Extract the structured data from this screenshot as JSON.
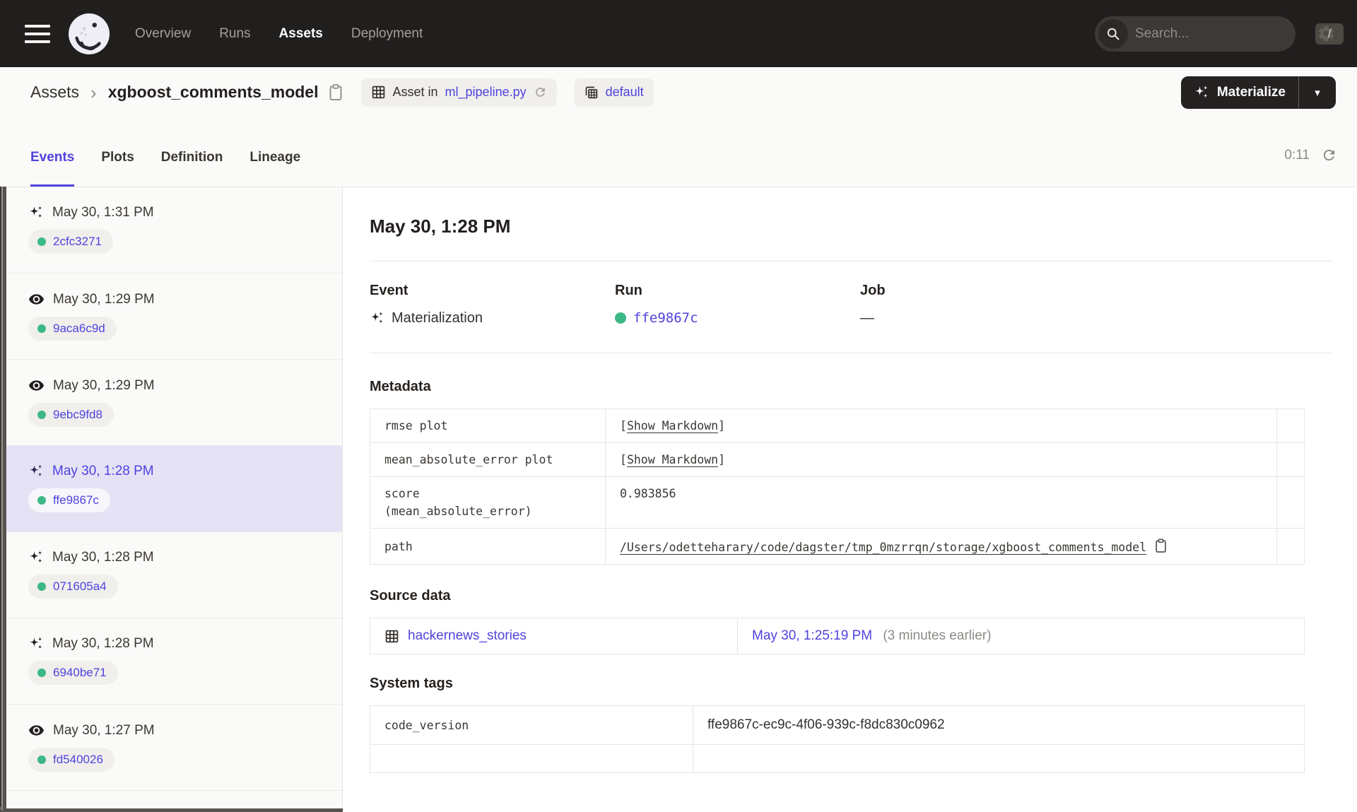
{
  "header": {
    "nav": [
      {
        "label": "Overview",
        "active": false
      },
      {
        "label": "Runs",
        "active": false
      },
      {
        "label": "Assets",
        "active": true
      },
      {
        "label": "Deployment",
        "active": false
      }
    ],
    "search": {
      "placeholder": "Search...",
      "shortcut": "/"
    }
  },
  "breadcrumb": {
    "root": "Assets",
    "separator": "›",
    "title": "xgboost_comments_model",
    "asset_tag": {
      "prefix": "Asset in",
      "file": "ml_pipeline.py"
    },
    "repo_tag": "default",
    "materialize_label": "Materialize",
    "caret": "▾"
  },
  "tabs": {
    "items": [
      "Events",
      "Plots",
      "Definition",
      "Lineage"
    ],
    "active": "Events",
    "timer": "0:11"
  },
  "sidebar": {
    "items": [
      {
        "type": "materialization",
        "time": "May 30, 1:31 PM",
        "run_id": "2cfc3271",
        "selected": false
      },
      {
        "type": "observation",
        "time": "May 30, 1:29 PM",
        "run_id": "9aca6c9d",
        "selected": false
      },
      {
        "type": "observation",
        "time": "May 30, 1:29 PM",
        "run_id": "9ebc9fd8",
        "selected": false
      },
      {
        "type": "materialization",
        "time": "May 30, 1:28 PM",
        "run_id": "ffe9867c",
        "selected": true
      },
      {
        "type": "materialization",
        "time": "May 30, 1:28 PM",
        "run_id": "071605a4",
        "selected": false
      },
      {
        "type": "materialization",
        "time": "May 30, 1:28 PM",
        "run_id": "6940be71",
        "selected": false
      },
      {
        "type": "observation",
        "time": "May 30, 1:27 PM",
        "run_id": "fd540026",
        "selected": false
      }
    ]
  },
  "main": {
    "heading": "May 30, 1:28 PM",
    "summary": {
      "event_label": "Event",
      "event_value": "Materialization",
      "run_label": "Run",
      "run_value": "ffe9867c",
      "job_label": "Job",
      "job_value": "—"
    },
    "metadata": {
      "heading": "Metadata",
      "rows": [
        {
          "key": "rmse plot",
          "link_open": "[",
          "link_label": "Show Markdown",
          "link_close": "]"
        },
        {
          "key": "mean_absolute_error plot",
          "link_open": "[",
          "link_label": "Show Markdown",
          "link_close": "]"
        },
        {
          "key_line1": "score",
          "key_line2": "(mean_absolute_error)",
          "value": "0.983856"
        },
        {
          "key": "path",
          "value": "/Users/odetteharary/code/dagster/tmp_0mzrrqn/storage/xgboost_comments_model"
        }
      ]
    },
    "source_data": {
      "heading": "Source data",
      "asset": "hackernews_stories",
      "timestamp": "May 30, 1:25:19 PM",
      "relative": "(3 minutes earlier)"
    },
    "system_tags": {
      "heading": "System tags",
      "rows": [
        {
          "key": "code_version",
          "value": "ffe9867c-ec9c-4f06-939c-f8dc830c0962"
        }
      ]
    }
  },
  "colors": {
    "accent_indigo": "#4F43DD",
    "status_green": "#3CB885",
    "header_dark": "#211E1E",
    "selected_row": "#E5E2F6"
  }
}
